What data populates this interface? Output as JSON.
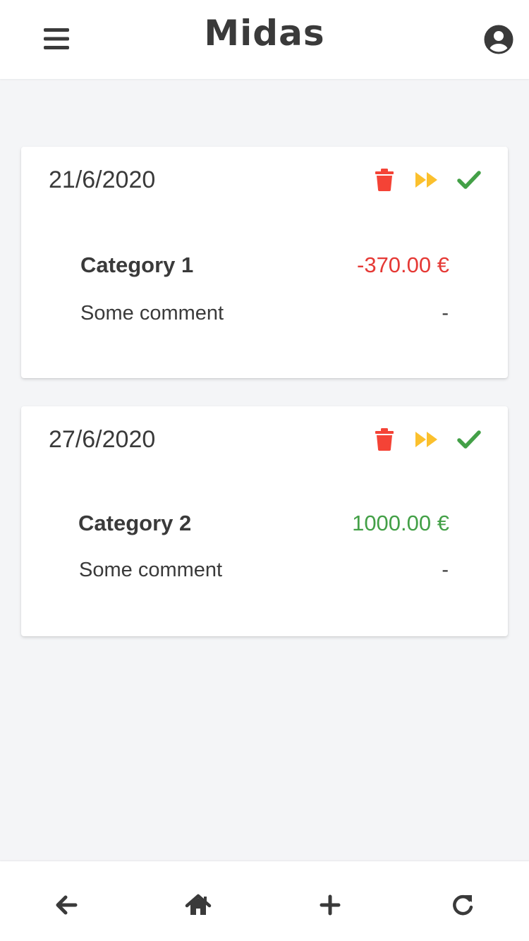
{
  "app": {
    "title": "Midas"
  },
  "header": {
    "menu_icon": "menu-icon",
    "account_icon": "account-circle-icon"
  },
  "colors": {
    "delete": "#f44336",
    "skip": "#fbc02d",
    "confirm": "#43a047",
    "negative_amount": "#e53935",
    "positive_amount": "#43a047",
    "text": "#3a3a3a",
    "background": "#f4f5f7"
  },
  "transactions": [
    {
      "date": "21/6/2020",
      "category": "Category 1",
      "amount": "-370.00 €",
      "amount_type": "negative",
      "comment": "Some comment",
      "comment_value": "-"
    },
    {
      "date": "27/6/2020",
      "category": "Category 2",
      "amount": "1000.00 €",
      "amount_type": "positive",
      "comment": "Some comment",
      "comment_value": "-"
    }
  ],
  "card_actions": [
    "trash-icon",
    "fast-forward-icon",
    "check-icon"
  ],
  "bottom_nav": [
    "arrow-left-icon",
    "home-icon",
    "plus-icon",
    "refresh-icon"
  ]
}
